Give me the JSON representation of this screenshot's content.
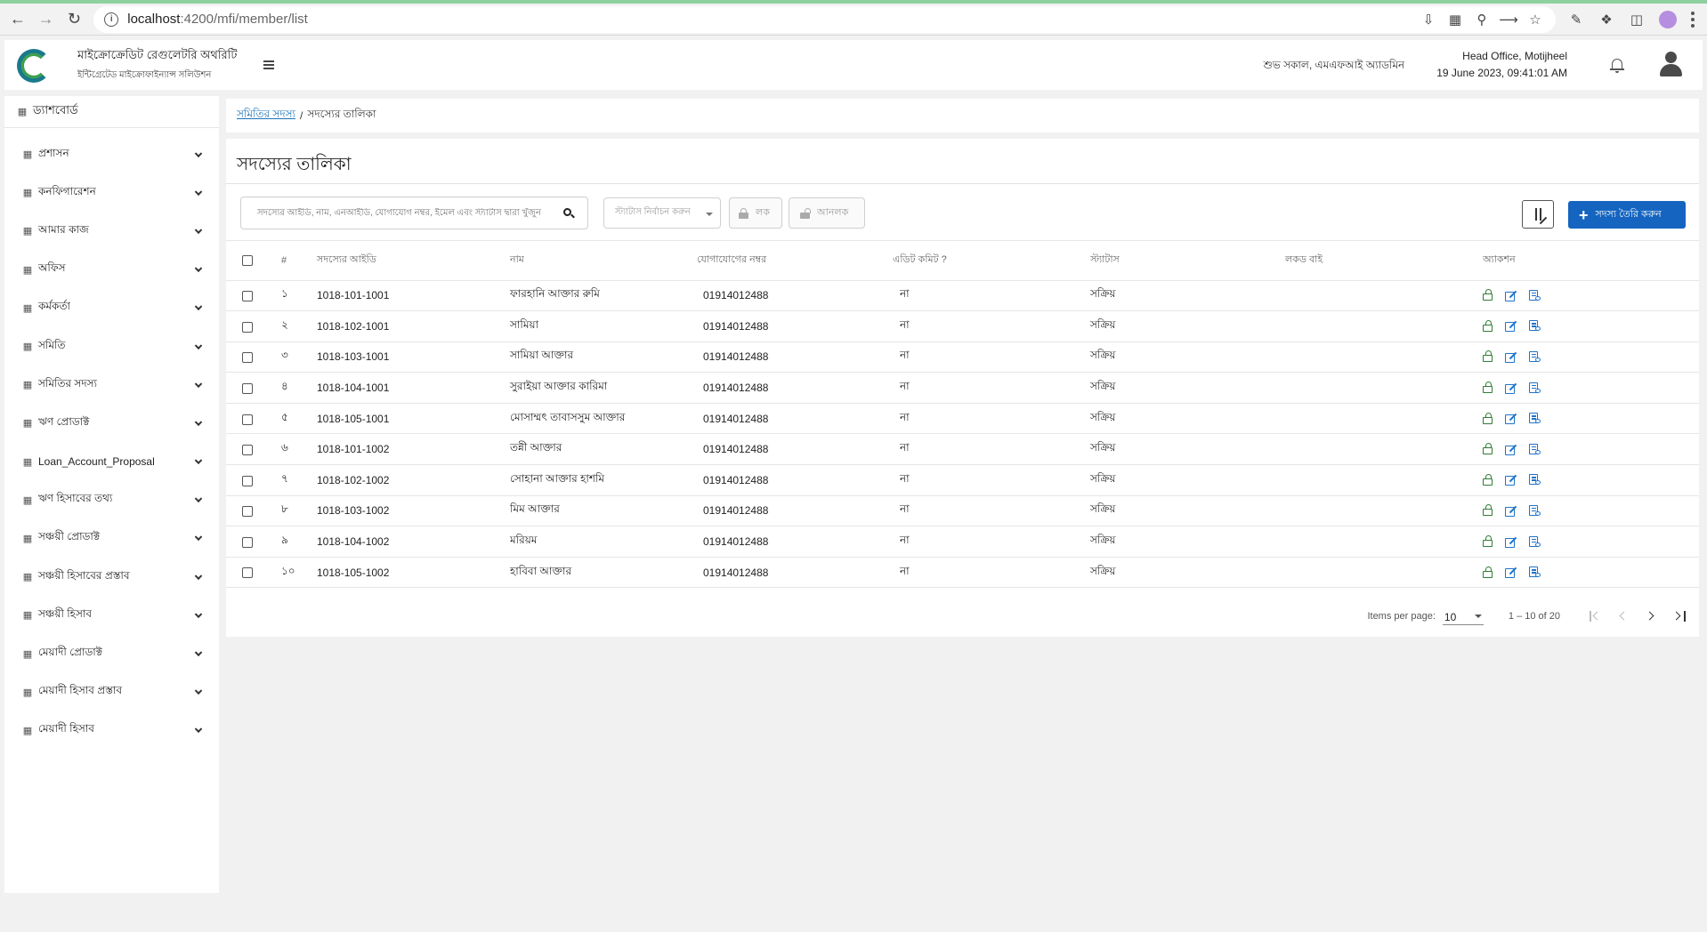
{
  "browser": {
    "url_host": "localhost",
    "url_path": ":4200/mfi/member/list"
  },
  "header": {
    "org_title": "মাইক্রোক্রেডিট রেগুলেটরি অথরিটি",
    "org_subtitle": "ইন্টিগ্রেটেড মাইক্রোফাইন্যান্স সলিউশন",
    "logo_text": "Microcredit Regulatory Authority",
    "greeting": "শুভ সকাল, এমএফআই অ্যাডমিন",
    "office": "Head Office, Motijheel",
    "datetime": "19 June 2023, 09:41:01 AM"
  },
  "sidebar": {
    "dashboard": "ড্যাশবোর্ড",
    "items": [
      {
        "label": "প্রশাসন",
        "icon": "sliders-icon"
      },
      {
        "label": "কনফিগারেশন",
        "icon": "sliders-icon"
      },
      {
        "label": "আমার কাজ",
        "icon": "task-icon"
      },
      {
        "label": "অফিস",
        "icon": "office-icon"
      },
      {
        "label": "কর্মকর্তা",
        "icon": "staff-icon"
      },
      {
        "label": "সমিতি",
        "icon": "group-icon"
      },
      {
        "label": "সমিতির সদস্য",
        "icon": "members-icon"
      },
      {
        "label": "ঋণ প্রোডাক্ট",
        "icon": "product-icon"
      },
      {
        "label": "Loan_Account_Proposal",
        "icon": "members-icon"
      },
      {
        "label": "ঋণ হিসাবের তথ্য",
        "icon": "account-icon"
      },
      {
        "label": "সঞ্চয়ী প্রোডাক্ট",
        "icon": "product-icon"
      },
      {
        "label": "সঞ্চয়ী হিসাবের প্রস্তাব",
        "icon": "proposal-icon"
      },
      {
        "label": "সঞ্চয়ী হিসাব",
        "icon": "account-icon"
      },
      {
        "label": "মেয়াদী প্রোডাক্ট",
        "icon": "product-icon"
      },
      {
        "label": "মেয়াদী হিসাব প্রস্তাব",
        "icon": "proposal-icon"
      },
      {
        "label": "মেয়াদী হিসাব",
        "icon": "account-icon"
      }
    ]
  },
  "breadcrumb": {
    "link": "সমিতির সদস্য",
    "separator": "/",
    "current": "সদস্যের তালিকা"
  },
  "page": {
    "title": "সদস্যের তালিকা",
    "search_placeholder": "সদস্যের আইডি, নাম, এনআইডি, যোগাযোগ নম্বর, ইমেল এবং স্ট্যাটাস দ্বারা খুঁজুন",
    "status_placeholder": "স্ট্যাটাস নির্বাচন করুন",
    "lock_label": "লক",
    "unlock_label": "আনলক",
    "create_label": "সদস্য তৈরি করুন"
  },
  "table": {
    "columns": [
      "#",
      "সদস্যের আইডি",
      "নাম",
      "যোগাযোগের নম্বর",
      "এডিট কমিট ?",
      "স্ট্যাটাস",
      "লকড বাই",
      "অ্যাকশন"
    ],
    "rows": [
      {
        "idx": "১",
        "id": "1018-101-1001",
        "name": "ফারহানি আক্তার রুমি",
        "phone": "01914012488",
        "edit": "না",
        "status": "সক্রিয়",
        "locked_by": ""
      },
      {
        "idx": "২",
        "id": "1018-102-1001",
        "name": "সামিয়া",
        "phone": "01914012488",
        "edit": "না",
        "status": "সক্রিয়",
        "locked_by": ""
      },
      {
        "idx": "৩",
        "id": "1018-103-1001",
        "name": "সামিয়া আক্তার",
        "phone": "01914012488",
        "edit": "না",
        "status": "সক্রিয়",
        "locked_by": ""
      },
      {
        "idx": "৪",
        "id": "1018-104-1001",
        "name": "সুরাইয়া আক্তার কারিমা",
        "phone": "01914012488",
        "edit": "না",
        "status": "সক্রিয়",
        "locked_by": ""
      },
      {
        "idx": "৫",
        "id": "1018-105-1001",
        "name": "মোসাম্মৎ তাবাসসুম আক্তার",
        "phone": "01914012488",
        "edit": "না",
        "status": "সক্রিয়",
        "locked_by": ""
      },
      {
        "idx": "৬",
        "id": "1018-101-1002",
        "name": "তন্নী আক্তার",
        "phone": "01914012488",
        "edit": "না",
        "status": "সক্রিয়",
        "locked_by": ""
      },
      {
        "idx": "৭",
        "id": "1018-102-1002",
        "name": "সোহানা আক্তার হাশমি",
        "phone": "01914012488",
        "edit": "না",
        "status": "সক্রিয়",
        "locked_by": ""
      },
      {
        "idx": "৮",
        "id": "1018-103-1002",
        "name": "মিম আক্তার",
        "phone": "01914012488",
        "edit": "না",
        "status": "সক্রিয়",
        "locked_by": ""
      },
      {
        "idx": "৯",
        "id": "1018-104-1002",
        "name": "মরিয়ম",
        "phone": "01914012488",
        "edit": "না",
        "status": "সক্রিয়",
        "locked_by": ""
      },
      {
        "idx": "১০",
        "id": "1018-105-1002",
        "name": "হাবিবা আক্তার",
        "phone": "01914012488",
        "edit": "না",
        "status": "সক্রিয়",
        "locked_by": ""
      }
    ]
  },
  "paginator": {
    "label": "Items per page:",
    "page_size": "10",
    "range": "1 – 10 of 20"
  },
  "colors": {
    "primary": "#1565c0",
    "lock_icon": "#2e7d32",
    "link": "#1a73b8"
  }
}
